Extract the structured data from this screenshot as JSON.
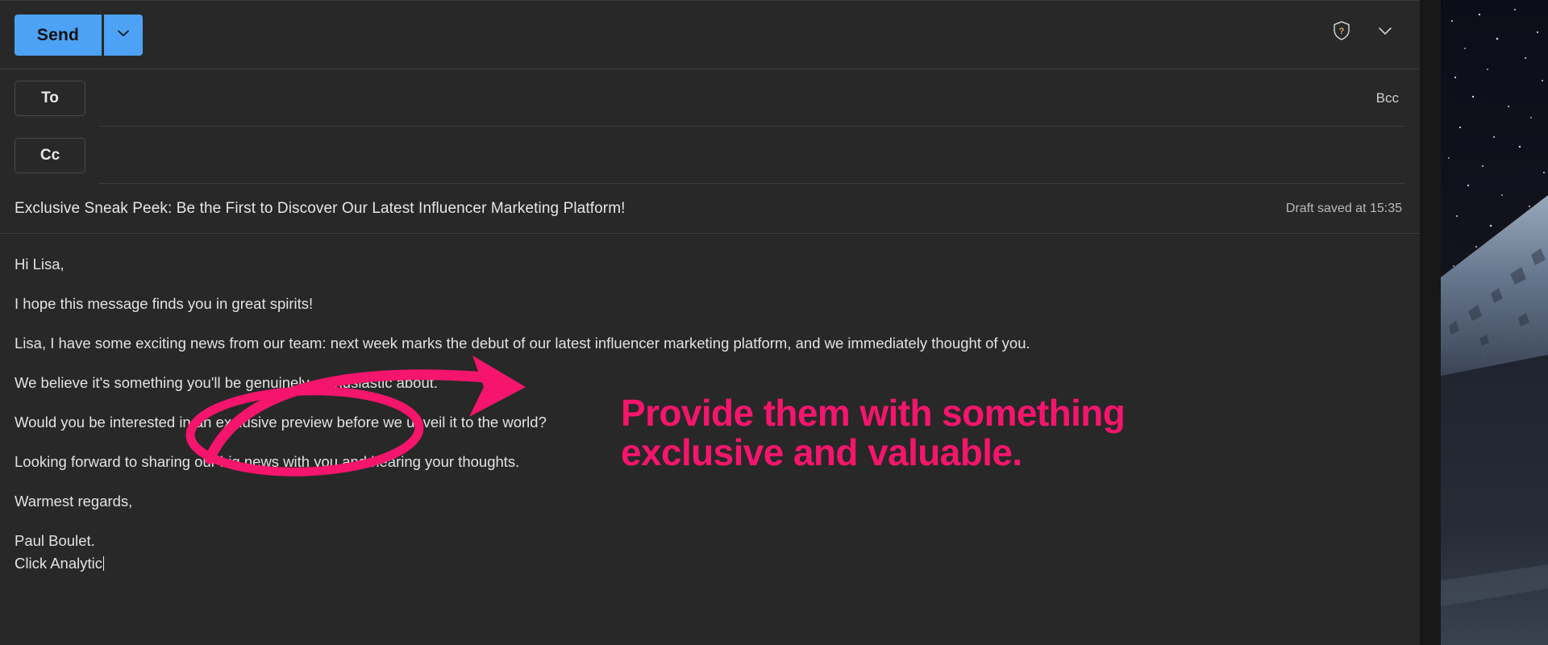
{
  "window": {
    "app": "mail-compose"
  },
  "toolbar": {
    "send_label": "Send",
    "send_caret_icon": "chevron-down-icon",
    "help_icon": "shield-question-icon",
    "overflow_icon": "chevron-down-icon"
  },
  "fields": {
    "to": {
      "label": "To",
      "value": "",
      "placeholder": ""
    },
    "cc": {
      "label": "Cc",
      "value": "",
      "placeholder": ""
    },
    "bcc_label": "Bcc",
    "subject": "Exclusive Sneak Peek: Be the First to Discover Our Latest Influencer Marketing Platform!",
    "draft_status": "Draft saved at 15:35"
  },
  "body": {
    "lines": [
      "Hi Lisa,",
      "I hope this message finds you in great spirits!",
      "Lisa, I have some exciting news from our team: next week marks the debut of our latest influencer marketing platform, and we immediately thought of you.",
      "We believe it's something you'll be genuinely enthusiastic about.",
      "Would you be interested in an exclusive preview before we unveil it to the world?",
      "Looking forward to sharing our big news with you and hearing your thoughts.",
      "Warmest regards,",
      "Paul Boulet.",
      "Click Analytic"
    ]
  },
  "annotation": {
    "color": "#f5156c",
    "line1": "Provide them with something",
    "line2": "exclusive and valuable.",
    "shapes": [
      "ellipse-highlight",
      "curved-arrow"
    ]
  },
  "colors": {
    "accent_send": "#4da2f5",
    "window_bg": "#282828",
    "text": "#e2e2e2",
    "annotation_pink": "#f5156c"
  },
  "desktop": {
    "wallpaper": "night-sky-snowy-mountain"
  }
}
